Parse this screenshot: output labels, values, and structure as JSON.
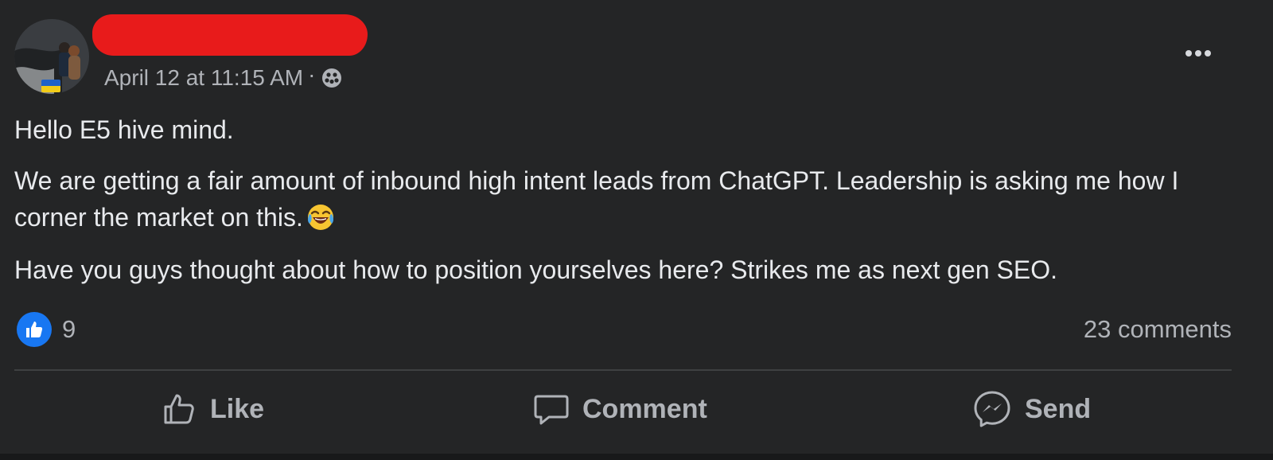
{
  "post": {
    "author": {
      "name_redacted": true,
      "avatar_icon": "profile-photo",
      "badge_icon": "ukraine-flag-icon"
    },
    "timestamp": "April 12 at 11:15 AM",
    "separator": "·",
    "privacy_icon": "group-privacy-icon",
    "more_icon": "more-options-icon",
    "paragraphs": {
      "p1": "Hello E5 hive mind.",
      "p2": "We are getting a fair amount of inbound high intent leads from ChatGPT. Leadership is asking me how I corner the market on this.",
      "p2_emoji": "face-with-tears-of-joy",
      "p3": "Have you guys thought about how to position yourselves here? Strikes me as next gen SEO."
    },
    "reactions": {
      "icon": "like-reaction-icon",
      "count": "9"
    },
    "comments_label": "23 comments"
  },
  "actions": {
    "like_label": "Like",
    "comment_label": "Comment",
    "send_label": "Send"
  },
  "colors": {
    "background": "#242526",
    "text_primary": "#e4e6eb",
    "text_secondary": "#b0b3b8",
    "accent_blue": "#1877f2",
    "redaction": "#e81b1b"
  }
}
